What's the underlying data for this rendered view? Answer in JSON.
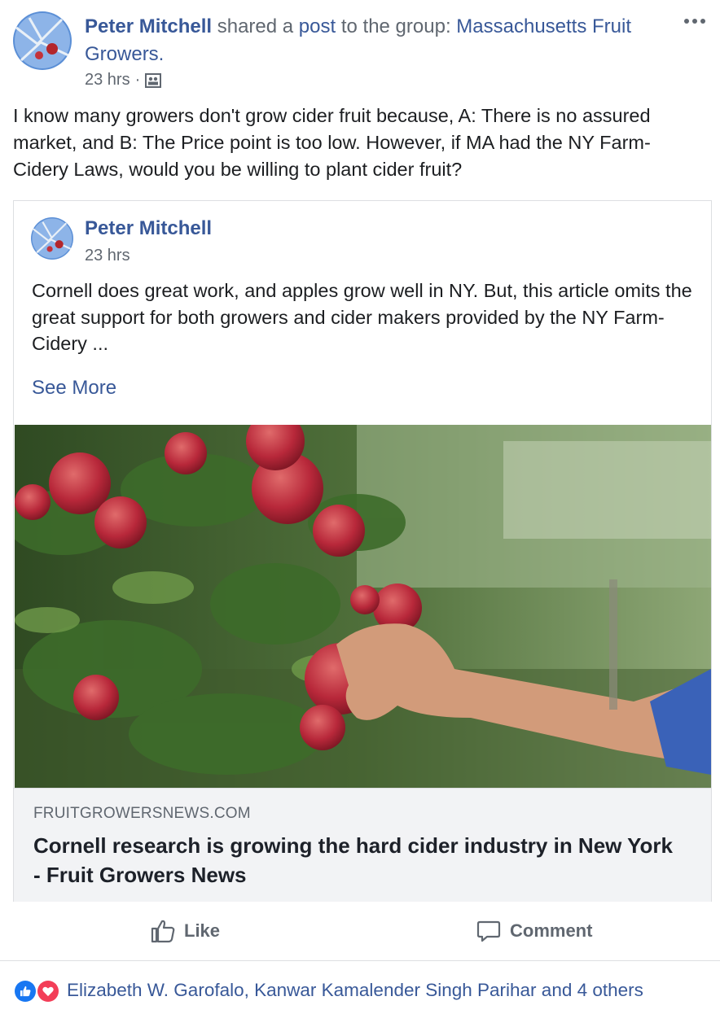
{
  "post": {
    "author": "Peter Mitchell",
    "action_text": "shared a",
    "post_link": "post",
    "to_text": "to the group:",
    "group": "Massachusetts Fruit Growers.",
    "time": "23 hrs",
    "separator": "·",
    "body": "I know many growers don't grow cider fruit because, A: There is no assured market, and B: The Price point is too low. However, if MA had the NY Farm-Cidery Laws, would you be willing to plant cider fruit?"
  },
  "shared": {
    "author": "Peter Mitchell",
    "time": "23 hrs",
    "body": "Cornell does great work, and apples grow well in NY. But, this article omits the great support for both growers and cider makers provided by the NY Farm-Cidery ...",
    "see_more": "See More",
    "link_domain": "FRUITGROWERSNEWS.COM",
    "link_title": "Cornell research is growing the hard cider industry in New York - Fruit Growers News"
  },
  "actions": {
    "like": "Like",
    "comment": "Comment"
  },
  "reactions": {
    "names": "Elizabeth W. Garofalo, Kanwar Kamalender Singh Parihar and 4 others",
    "icons": [
      "like-reaction-icon",
      "love-reaction-icon"
    ]
  },
  "colors": {
    "link": "#385898",
    "meta": "#606770",
    "text": "#1c1e21",
    "like_blue": "#1877f2",
    "love_red": "#f33e58"
  }
}
